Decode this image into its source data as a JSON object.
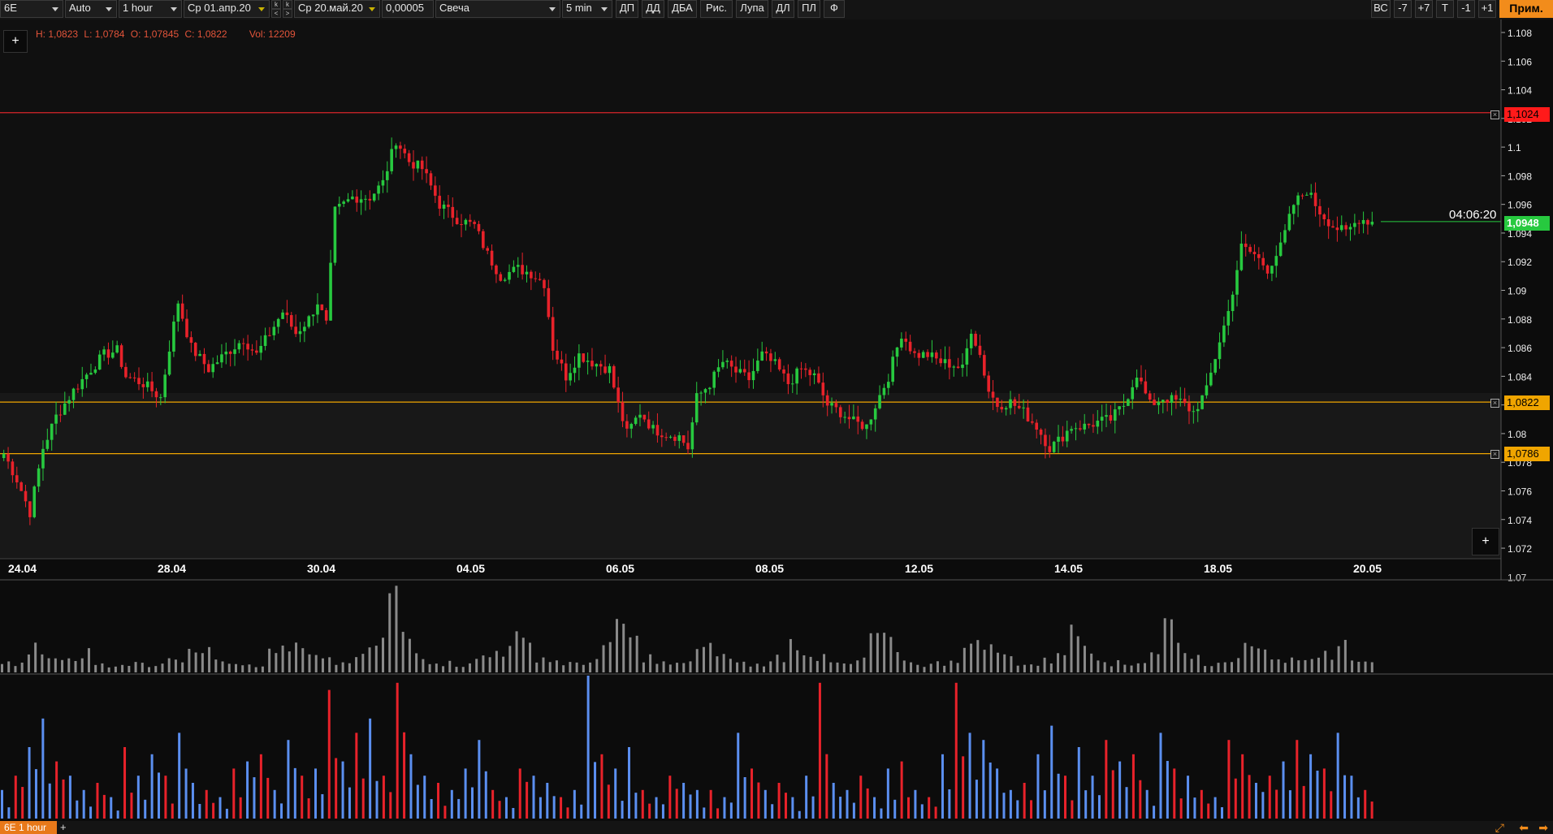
{
  "toolbar": {
    "symbol": "6E",
    "scale_mode": "Auto",
    "timeframe": "1 hour",
    "date_from": "Ср 01.апр.20",
    "date_to": "Ср 20.май.20",
    "tick_size": "0,00005",
    "chart_style": "Свеча",
    "aggregation": "5 min",
    "btn_dp": "ДП",
    "btn_dd": "ДД",
    "btn_dba": "ДБА",
    "btn_draw": "Рис.",
    "btn_magnifier": "Лупа",
    "btn_dl": "ДЛ",
    "btn_pl": "ПЛ",
    "btn_f": "Ф",
    "btn_vs": "ВС",
    "btn_minus7": "-7",
    "btn_plus7": "+7",
    "btn_t": "T",
    "btn_minus1": "-1",
    "btn_plus1": "+1",
    "btn_apply": "Прим.",
    "nav_k": "k",
    "nav_left": "<",
    "nav_right": ">"
  },
  "ohlc": {
    "h": "H: 1,0823",
    "l": "L: 1,0784",
    "o": "O: 1,07845",
    "c": "C: 1,0822",
    "vol": "Vol: 12209"
  },
  "buttons": {
    "plus": "+",
    "add_sheet": "+"
  },
  "price_levels": [
    {
      "label": "1,1024",
      "value": 1.1024,
      "color": "#ff1a1a",
      "line_color": "#d8242a"
    },
    {
      "label": "1,0822",
      "value": 1.0822,
      "color": "#f0a500",
      "line_color": "#f0a500"
    },
    {
      "label": "1,0786",
      "value": 1.0786,
      "color": "#f0a500",
      "line_color": "#f0a500"
    }
  ],
  "current_price": {
    "label": "1,0948",
    "value": 1.0948,
    "color": "#27c93f"
  },
  "timer": "04:06:20",
  "sheet_tab": "6E 1 hour",
  "colors": {
    "bull": "#27c93f",
    "bear": "#e8222a",
    "volume": "#8a8a8a",
    "delta_pos": "#5b8ff0",
    "delta_neg": "#e8222a",
    "accent": "#f28c1b"
  },
  "chart_data": {
    "type": "candlestick",
    "ylim": [
      1.07,
      1.109
    ],
    "y_ticks": [
      "1.108",
      "1.106",
      "1.104",
      "1.102",
      "1.1",
      "1.098",
      "1.096",
      "1.094",
      "1.092",
      "1.09",
      "1.088",
      "1.086",
      "1.084",
      "1.082",
      "1.08",
      "1.078",
      "1.076",
      "1.074",
      "1.072",
      "1.07"
    ],
    "x_ticks": [
      "24.04",
      "28.04",
      "30.04",
      "04.05",
      "06.05",
      "08.05",
      "12.05",
      "14.05",
      "18.05",
      "20.05"
    ],
    "close_anchors": [
      [
        0,
        1.0786
      ],
      [
        3,
        1.0768
      ],
      [
        6,
        1.0745
      ],
      [
        9,
        1.079
      ],
      [
        12,
        1.0812
      ],
      [
        16,
        1.083
      ],
      [
        20,
        1.0845
      ],
      [
        23,
        1.0855
      ],
      [
        26,
        1.0858
      ],
      [
        28,
        1.084
      ],
      [
        32,
        1.0835
      ],
      [
        36,
        1.0825
      ],
      [
        38,
        1.086
      ],
      [
        40,
        1.0892
      ],
      [
        43,
        1.086
      ],
      [
        47,
        1.0845
      ],
      [
        51,
        1.0856
      ],
      [
        55,
        1.0866
      ],
      [
        58,
        1.0855
      ],
      [
        61,
        1.087
      ],
      [
        64,
        1.0885
      ],
      [
        67,
        1.087
      ],
      [
        70,
        1.088
      ],
      [
        72,
        1.0892
      ],
      [
        74,
        1.0876
      ],
      [
        76,
        1.0955
      ],
      [
        80,
        1.0965
      ],
      [
        84,
        1.0965
      ],
      [
        87,
        1.0975
      ],
      [
        90,
        1.1005
      ],
      [
        93,
        1.099
      ],
      [
        96,
        1.0985
      ],
      [
        100,
        1.096
      ],
      [
        104,
        1.095
      ],
      [
        108,
        1.0945
      ],
      [
        111,
        1.0925
      ],
      [
        114,
        1.091
      ],
      [
        118,
        1.0915
      ],
      [
        121,
        1.0912
      ],
      [
        124,
        1.0905
      ],
      [
        126,
        1.086
      ],
      [
        129,
        1.084
      ],
      [
        132,
        1.0855
      ],
      [
        135,
        1.085
      ],
      [
        139,
        1.0845
      ],
      [
        141,
        1.082
      ],
      [
        143,
        1.08
      ],
      [
        146,
        1.0815
      ],
      [
        149,
        1.0803
      ],
      [
        152,
        1.08
      ],
      [
        155,
        1.0798
      ],
      [
        157,
        1.079
      ],
      [
        159,
        1.0825
      ],
      [
        162,
        1.0835
      ],
      [
        165,
        1.085
      ],
      [
        168,
        1.0843
      ],
      [
        171,
        1.0838
      ],
      [
        174,
        1.0855
      ],
      [
        177,
        1.0848
      ],
      [
        180,
        1.0835
      ],
      [
        183,
        1.0845
      ],
      [
        186,
        1.084
      ],
      [
        189,
        1.082
      ],
      [
        192,
        1.0815
      ],
      [
        195,
        1.0808
      ],
      [
        198,
        1.0805
      ],
      [
        200,
        1.082
      ],
      [
        203,
        1.084
      ],
      [
        206,
        1.087
      ],
      [
        209,
        1.0855
      ],
      [
        212,
        1.0855
      ],
      [
        215,
        1.085
      ],
      [
        218,
        1.0848
      ],
      [
        220,
        1.0845
      ],
      [
        222,
        1.0873
      ],
      [
        224,
        1.0855
      ],
      [
        226,
        1.083
      ],
      [
        228,
        1.082
      ],
      [
        231,
        1.0822
      ],
      [
        234,
        1.0815
      ],
      [
        237,
        1.0805
      ],
      [
        240,
        1.079
      ],
      [
        242,
        1.0795
      ],
      [
        245,
        1.0805
      ],
      [
        248,
        1.0805
      ],
      [
        251,
        1.0808
      ],
      [
        254,
        1.081
      ],
      [
        257,
        1.082
      ],
      [
        260,
        1.0842
      ],
      [
        263,
        1.082
      ],
      [
        266,
        1.0825
      ],
      [
        270,
        1.0822
      ],
      [
        273,
        1.0815
      ],
      [
        276,
        1.083
      ],
      [
        279,
        1.0865
      ],
      [
        281,
        1.0885
      ],
      [
        284,
        1.093
      ],
      [
        287,
        1.0925
      ],
      [
        290,
        1.0915
      ],
      [
        293,
        1.093
      ],
      [
        296,
        1.096
      ],
      [
        299,
        1.097
      ],
      [
        302,
        1.0955
      ],
      [
        305,
        1.0945
      ],
      [
        308,
        1.094
      ],
      [
        311,
        1.095
      ],
      [
        314,
        1.0948
      ]
    ],
    "volume_profile": [
      0.12,
      0.1,
      0.3,
      0.2,
      0.18,
      0.15,
      0.25,
      0.12,
      0.1,
      0.08,
      0.12,
      0.1,
      0.15,
      0.2,
      0.35,
      0.25,
      0.2,
      0.15,
      0.12,
      0.1,
      0.25,
      0.35,
      0.3,
      0.2,
      0.15,
      0.12,
      0.15,
      0.25,
      0.4,
      1.0,
      0.45,
      0.25,
      0.15,
      0.12,
      0.1,
      0.15,
      0.2,
      0.28,
      0.45,
      0.35,
      0.2,
      0.15,
      0.12,
      0.1,
      0.18,
      0.3,
      0.65,
      0.4,
      0.2,
      0.12,
      0.1,
      0.15,
      0.28,
      0.3,
      0.2,
      0.12,
      0.1,
      0.12,
      0.2,
      0.4,
      0.28,
      0.18,
      0.12,
      0.1,
      0.15,
      0.5,
      0.4,
      0.2,
      0.12,
      0.1,
      0.12,
      0.18,
      0.3,
      0.45,
      0.3,
      0.2,
      0.12,
      0.1,
      0.15,
      0.3,
      0.5,
      0.38,
      0.2,
      0.12,
      0.1,
      0.15,
      0.28,
      0.65,
      0.35,
      0.2,
      0.12,
      0.1,
      0.18,
      0.5,
      0.4,
      0.22,
      0.15,
      0.12,
      0.15,
      0.25,
      0.35,
      0.2,
      0.12
    ],
    "delta": [
      0.2,
      -0.3,
      0.5,
      0.7,
      -0.4,
      0.3,
      0.2,
      -0.25,
      0.15,
      -0.5,
      0.3,
      0.45,
      -0.3,
      0.6,
      0.25,
      -0.2,
      0.15,
      -0.35,
      0.4,
      -0.45,
      0.2,
      0.55,
      -0.3,
      0.35,
      -0.9,
      0.4,
      -0.6,
      0.7,
      -0.3,
      -0.95,
      0.45,
      0.3,
      -0.25,
      0.2,
      0.35,
      0.55,
      -0.2,
      0.15,
      -0.35,
      0.3,
      0.25,
      -0.15,
      0.2,
      1.0,
      -0.45,
      0.35,
      0.5,
      -0.2,
      0.15,
      -0.3,
      0.25,
      0.2,
      -0.2,
      0.15,
      0.6,
      -0.35,
      0.2,
      -0.25,
      0.15,
      0.3,
      -0.95,
      0.25,
      0.2,
      -0.3,
      0.15,
      0.35,
      -0.4,
      0.2,
      -0.15,
      0.45,
      -0.95,
      0.6,
      0.55,
      0.35,
      0.2,
      -0.25,
      0.45,
      0.65,
      -0.3,
      0.5,
      0.3,
      -0.55,
      0.4,
      -0.45,
      0.2,
      0.6,
      -0.35,
      0.3,
      -0.2,
      0.15,
      -0.55,
      -0.45,
      0.25,
      -0.3,
      0.4,
      -0.55,
      0.45,
      -0.35,
      0.6,
      0.3,
      -0.2
    ]
  }
}
